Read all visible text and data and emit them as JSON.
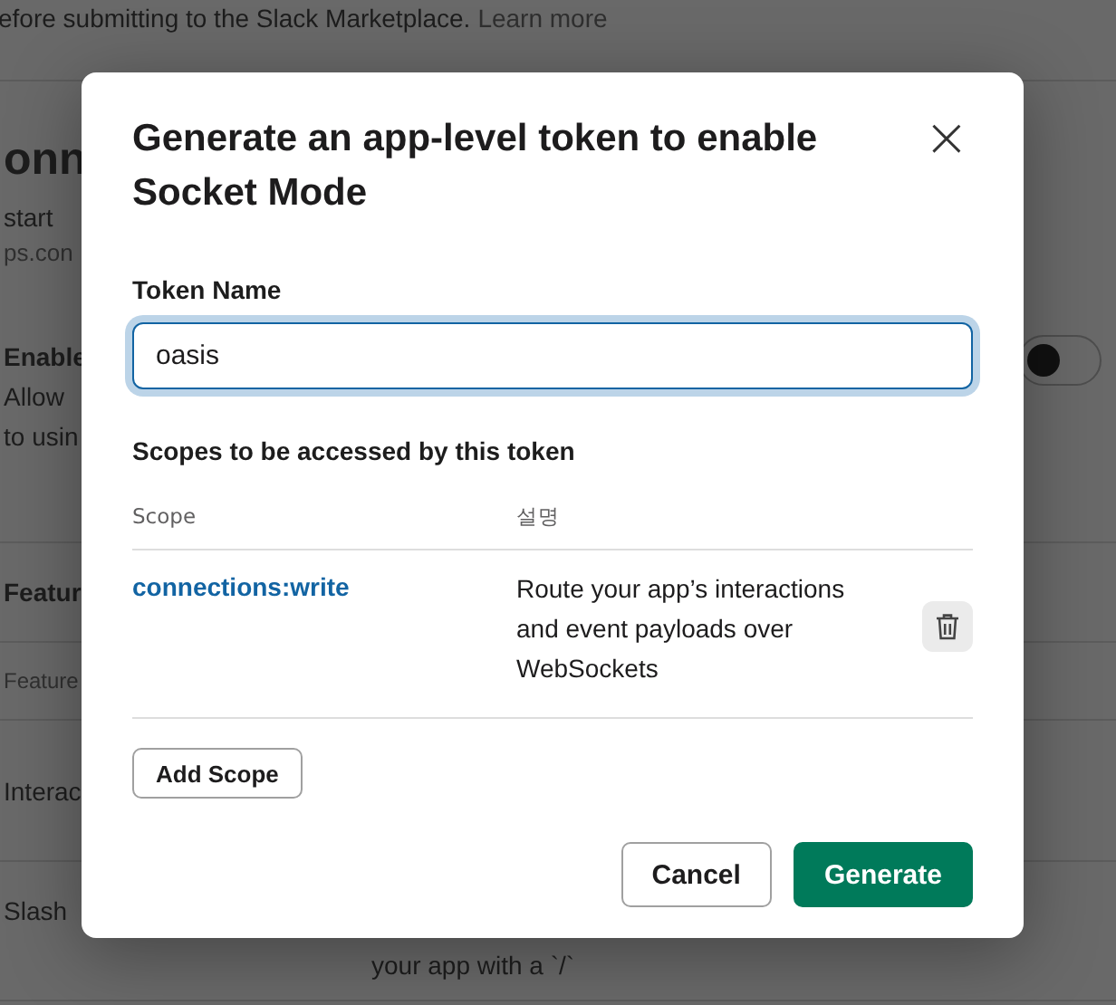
{
  "background": {
    "notice": "efore submitting to the Slack Marketplace.",
    "notice_link": "Learn more",
    "sections": [
      {
        "kind": "intro",
        "lines": [
          {
            "kind": "title",
            "text": "onn"
          },
          {
            "kind": "text",
            "text": "start"
          },
          {
            "kind": "muted",
            "text": "ps.con"
          }
        ]
      },
      {
        "kind": "setting",
        "lines": [
          {
            "kind": "bold",
            "text": "Enable"
          },
          {
            "kind": "text",
            "text": "Allow"
          },
          {
            "kind": "text",
            "text": "to usin"
          }
        ],
        "toggle": {
          "on": false
        }
      },
      {
        "kind": "heading",
        "lines": [
          {
            "kind": "bold",
            "text": "Featur"
          }
        ]
      },
      {
        "kind": "label",
        "lines": [
          {
            "kind": "small",
            "text": "Feature"
          }
        ]
      },
      {
        "kind": "row",
        "lines": [
          {
            "kind": "text",
            "text": "Interac"
          }
        ]
      },
      {
        "kind": "row",
        "lines": [
          {
            "kind": "text",
            "text": "Slash"
          }
        ],
        "aside": "your app with a `/`"
      }
    ]
  },
  "dialog": {
    "title": "Generate an app-level token to enable Socket Mode",
    "close": "×",
    "token_label": "Token Name",
    "token_value": "oasis",
    "scopes_label": "Scopes to be accessed by this token",
    "columns": [
      "Scope",
      "설명"
    ],
    "rows": [
      {
        "scope": "connections:write",
        "description": "Route your app’s interactions and event payloads over WebSockets"
      }
    ],
    "add_button": "Add Scope",
    "buttons": [
      {
        "label": "Cancel",
        "kind": "secondary"
      },
      {
        "label": "Generate",
        "kind": "primary"
      }
    ]
  }
}
